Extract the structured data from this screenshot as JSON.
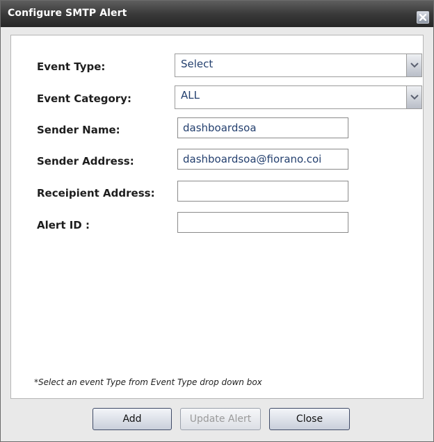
{
  "window": {
    "title": "Configure SMTP Alert",
    "close_icon": "close-icon"
  },
  "form": {
    "event_type": {
      "label": "Event Type:",
      "value": "Select"
    },
    "event_category": {
      "label": "Event Category:",
      "value": "ALL"
    },
    "sender_name": {
      "label": "Sender Name:",
      "value": "dashboardsoa"
    },
    "sender_address": {
      "label": "Sender Address:",
      "value": "dashboardsoa@fiorano.coi"
    },
    "recipient_address": {
      "label": "Receipient Address:",
      "value": ""
    },
    "alert_id": {
      "label": "Alert ID :",
      "value": ""
    }
  },
  "note": "*Select an event Type from Event Type drop down box",
  "buttons": {
    "add": "Add",
    "update": "Update Alert",
    "close": "Close"
  }
}
